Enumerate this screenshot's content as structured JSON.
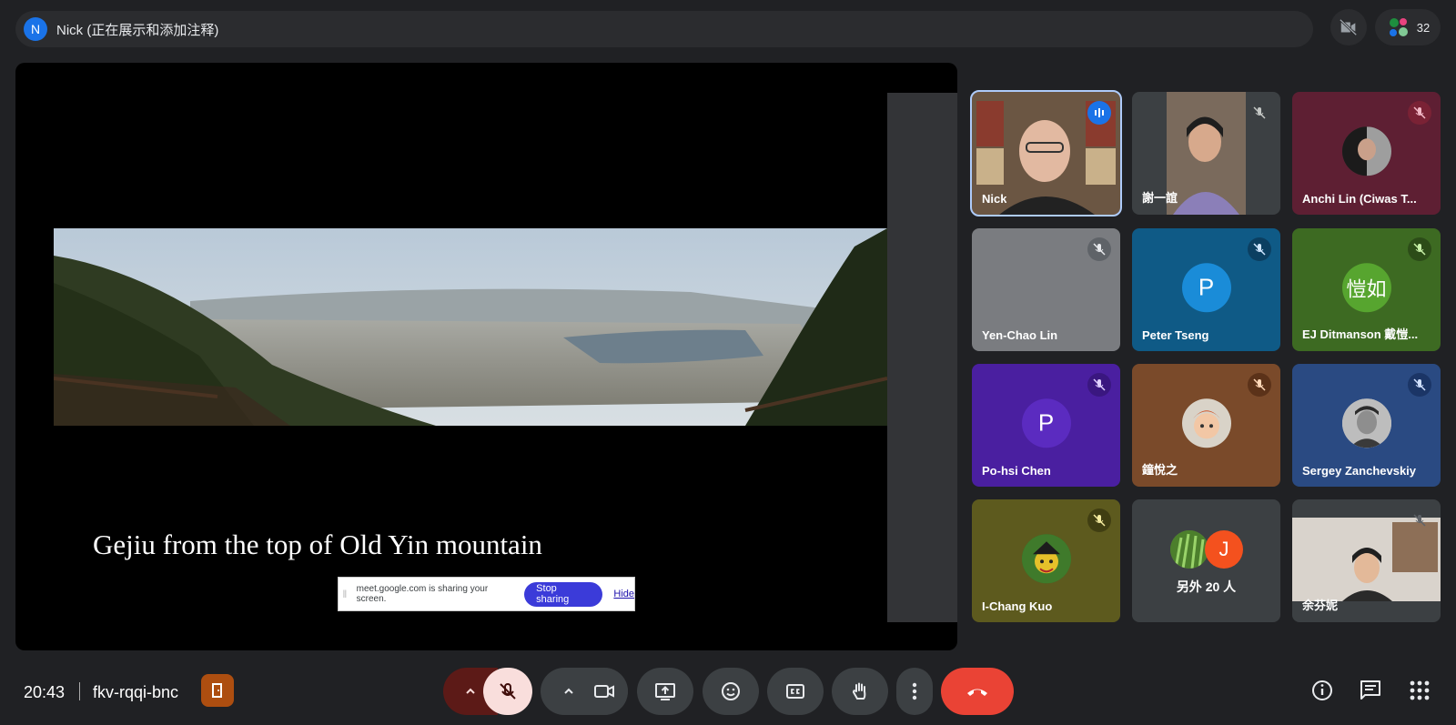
{
  "presenter": {
    "initial": "N",
    "label": "Nick (正在展示和添加注释)"
  },
  "participant_count": "32",
  "slide": {
    "caption": "Gejiu from the top of Old Yin mountain"
  },
  "share_notice": {
    "text": "meet.google.com is sharing your screen.",
    "stop_label": "Stop sharing",
    "hide_label": "Hide"
  },
  "tiles": [
    {
      "name": "Nick"
    },
    {
      "name": "謝一誼"
    },
    {
      "name": "Anchi Lin (Ciwas T..."
    },
    {
      "name": "Yen-Chao Lin"
    },
    {
      "name": "Peter Tseng",
      "initial": "P"
    },
    {
      "name": "EJ Ditmanson 戴愷...",
      "initial": "愷如"
    },
    {
      "name": "Po-hsi Chen",
      "initial": "P"
    },
    {
      "name": "鐘悅之"
    },
    {
      "name": "Sergey Zanchevskiy"
    },
    {
      "name": "I-Chang Kuo"
    },
    {
      "name": "另外 20 人",
      "initial": "J"
    },
    {
      "name": "余芬妮"
    }
  ],
  "footer": {
    "time": "20:43",
    "meeting_code": "fkv-rqqi-bnc"
  },
  "colors": {
    "accent_blue": "#1a73e8",
    "end_call_red": "#ea4335",
    "mic_off_bg": "#f9dedc",
    "bg": "#202124"
  }
}
